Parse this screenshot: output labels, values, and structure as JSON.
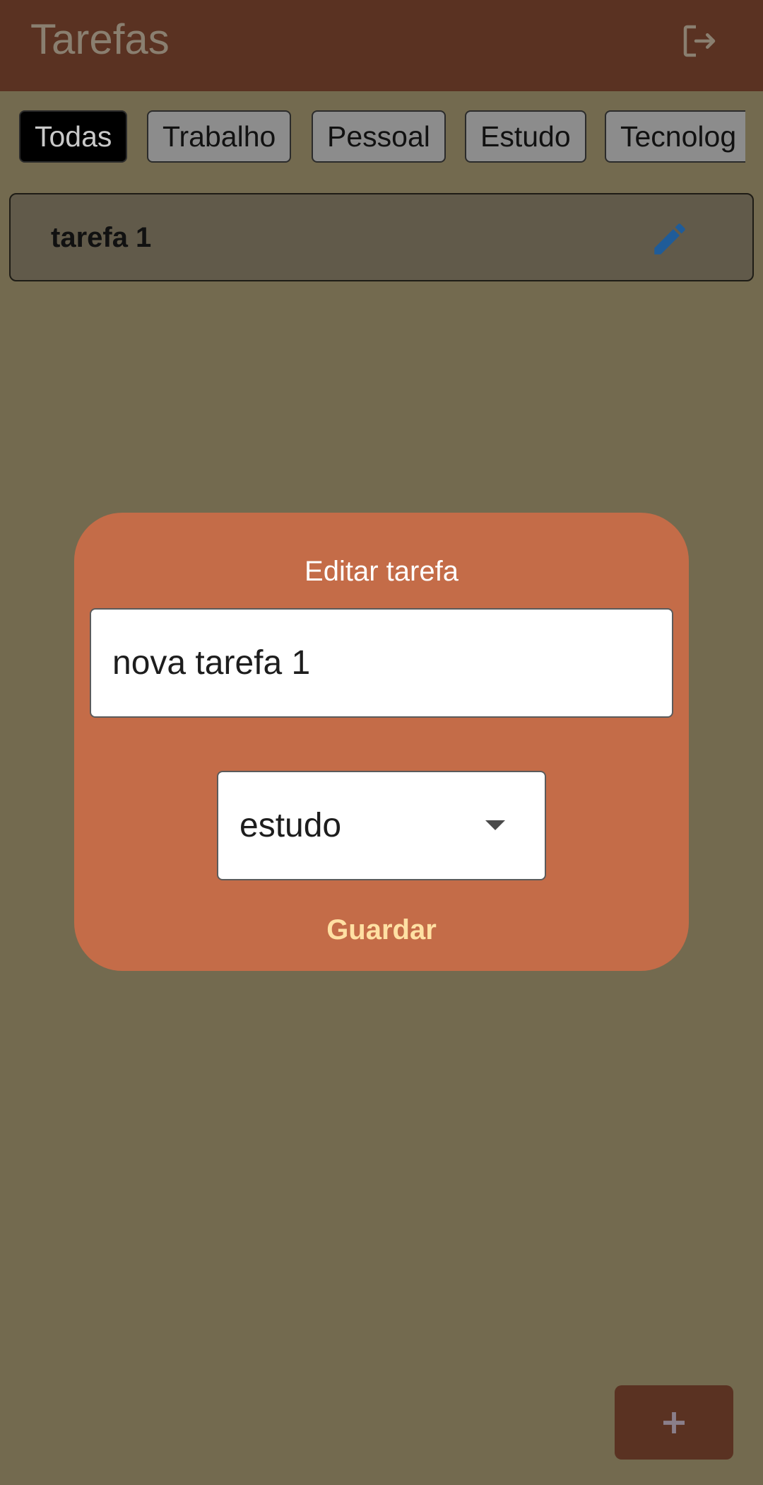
{
  "app_bar": {
    "title": "Tarefas",
    "logout_icon": "logout-icon"
  },
  "filters": [
    {
      "label": "Todas",
      "selected": true
    },
    {
      "label": "Trabalho",
      "selected": false
    },
    {
      "label": "Pessoal",
      "selected": false
    },
    {
      "label": "Estudo",
      "selected": false
    },
    {
      "label": "Tecnolog",
      "selected": false
    }
  ],
  "tasks": [
    {
      "title": "tarefa 1",
      "action_icon": "edit-icon"
    }
  ],
  "dialog": {
    "title": "Editar tarefa",
    "name_value": "nova tarefa 1",
    "category_value": "estudo",
    "save_label": "Guardar"
  },
  "fab": {
    "label": "+",
    "icon": "add-icon"
  },
  "colors": {
    "background": "#736a4f",
    "app_bar": "#5a3222",
    "dialog": "#c46c48",
    "accent_button": "#ffe0a3",
    "edit_icon": "#1f5c99"
  }
}
